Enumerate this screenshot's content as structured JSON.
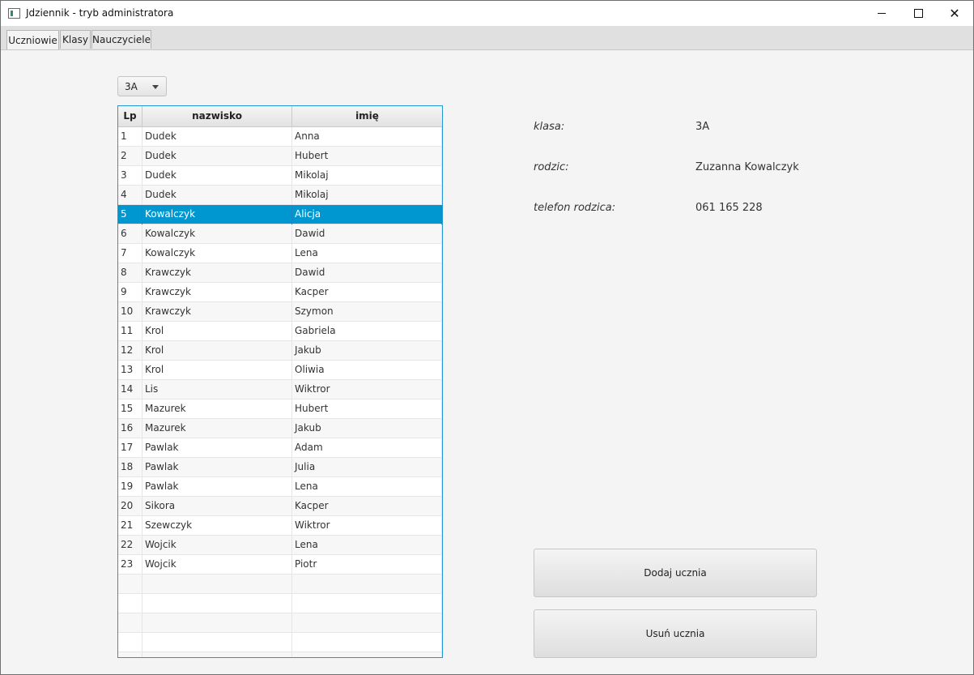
{
  "window": {
    "title": "Jdziennik - tryb administratora",
    "controls": {
      "minimize": "minimize-icon",
      "maximize": "maximize-icon",
      "close": "close-icon"
    }
  },
  "tabs": [
    {
      "label": "Uczniowie",
      "active": true
    },
    {
      "label": "Klasy",
      "active": false
    },
    {
      "label": "Nauczyciele",
      "active": false
    }
  ],
  "class_select": {
    "value": "3A"
  },
  "table": {
    "columns": [
      "Lp",
      "nazwisko",
      "imię"
    ],
    "selected_lp": "5",
    "rows": [
      [
        "1",
        "Dudek",
        "Anna"
      ],
      [
        "2",
        "Dudek",
        "Hubert"
      ],
      [
        "3",
        "Dudek",
        "Mikolaj"
      ],
      [
        "4",
        "Dudek",
        "Mikolaj"
      ],
      [
        "5",
        "Kowalczyk",
        "Alicja"
      ],
      [
        "6",
        "Kowalczyk",
        "Dawid"
      ],
      [
        "7",
        "Kowalczyk",
        "Lena"
      ],
      [
        "8",
        "Krawczyk",
        "Dawid"
      ],
      [
        "9",
        "Krawczyk",
        "Kacper"
      ],
      [
        "10",
        "Krawczyk",
        "Szymon"
      ],
      [
        "11",
        "Krol",
        "Gabriela"
      ],
      [
        "12",
        "Krol",
        "Jakub"
      ],
      [
        "13",
        "Krol",
        "Oliwia"
      ],
      [
        "14",
        "Lis",
        "Wiktror"
      ],
      [
        "15",
        "Mazurek",
        "Hubert"
      ],
      [
        "16",
        "Mazurek",
        "Jakub"
      ],
      [
        "17",
        "Pawlak",
        "Adam"
      ],
      [
        "18",
        "Pawlak",
        "Julia"
      ],
      [
        "19",
        "Pawlak",
        "Lena"
      ],
      [
        "20",
        "Sikora",
        "Kacper"
      ],
      [
        "21",
        "Szewczyk",
        "Wiktror"
      ],
      [
        "22",
        "Wojcik",
        "Lena"
      ],
      [
        "23",
        "Wojcik",
        "Piotr"
      ]
    ]
  },
  "details": {
    "class_label": "klasa:",
    "class_value": "3A",
    "parent_label": "rodzic:",
    "parent_value": "Zuzanna Kowalczyk",
    "phone_label": "telefon rodzica:",
    "phone_value": "061 165 228"
  },
  "buttons": {
    "add": "Dodaj ucznia",
    "remove": "Usuń ucznia"
  },
  "colors": {
    "selection": "#0097d0",
    "table_border": "#2396d5"
  }
}
